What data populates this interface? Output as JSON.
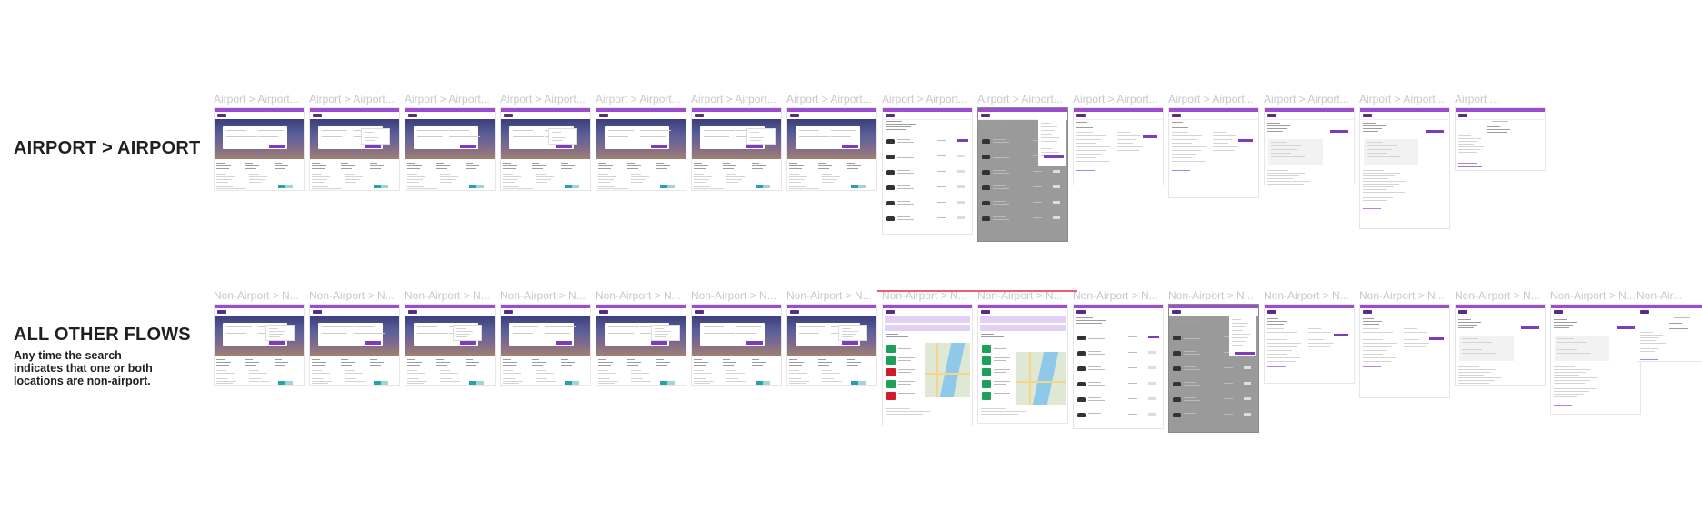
{
  "rows": [
    {
      "heading": "AIRPORT > AIRPORT",
      "subtext": "",
      "frames": [
        "Airport > Airport...",
        "Airport > Airport...",
        "Airport > Airport...",
        "Airport > Airport...",
        "Airport > Airport...",
        "Airport > Airport...",
        "Airport > Airport...",
        "Airport > Airport...",
        "Airport > Airport...",
        "Airport > Airport...",
        "Airport > Airport...",
        "Airport > Airport...",
        "Airport > Airport...",
        "Airport ..."
      ]
    },
    {
      "heading": "ALL OTHER FLOWS",
      "subtext": "Any time the search indicates that one or both locations are non-airport.",
      "frames": [
        "Non-Airport > N...",
        "Non-Airport > N...",
        "Non-Airport > N...",
        "Non-Airport > N...",
        "Non-Airport > N...",
        "Non-Airport > N...",
        "Non-Airport > N...",
        "Non-Airport > N...",
        "Non-Airport > N...",
        "Non-Airport > N...",
        "Non-Airport > N...",
        "Non-Airport > N...",
        "Non-Airport > N...",
        "Non-Airport > N...",
        "Non-Airport > N...",
        "Non-Air..."
      ]
    }
  ],
  "colors": {
    "accent": "#9b4ccf",
    "button": "#7d3cc0",
    "overlay": "#9a9a9a",
    "map_water": "#8ec9ea",
    "badge_green": "#1ea05a",
    "badge_red": "#d11a2a",
    "label_muted": "#c9c9c9"
  }
}
